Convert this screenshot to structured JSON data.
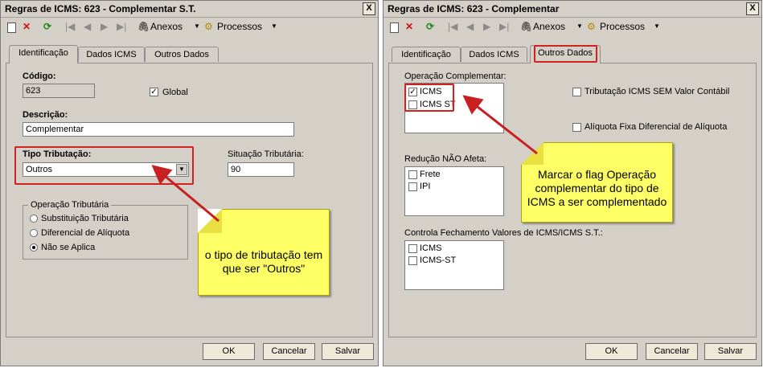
{
  "left_window": {
    "title": "Regras de ICMS: 623 - Complementar S.T.",
    "close": "X",
    "toolbar": {
      "anexos": "Anexos",
      "processos": "Processos"
    },
    "tabs": [
      "Identificação",
      "Dados ICMS",
      "Outros Dados"
    ],
    "codigo_label": "Código:",
    "codigo_value": "623",
    "global_label": "Global",
    "global_checked": "✓",
    "descricao_label": "Descrição:",
    "descricao_value": "Complementar",
    "tipo_label": "Tipo Tributação:",
    "tipo_value": "Outros",
    "situacao_label": "Situação Tributária:",
    "situacao_value": "90",
    "operacao_group": "Operação Tributária",
    "operacao_options": [
      "Substituição Tributária",
      "Diferencial de Alíquota",
      "Não se Aplica"
    ],
    "note": "o tipo de tributação tem que ser \"Outros\"",
    "buttons": {
      "ok": "OK",
      "cancel": "Cancelar",
      "save": "Salvar"
    }
  },
  "right_window": {
    "title": "Regras de ICMS: 623 - Complementar",
    "close": "X",
    "toolbar": {
      "anexos": "Anexos",
      "processos": "Processos"
    },
    "tabs": [
      "Identificação",
      "Dados ICMS",
      "Outros Dados"
    ],
    "op_complementar_label": "Operação Complementar:",
    "op_complementar_items": [
      "ICMS",
      "ICMS ST"
    ],
    "icms_checked": "✓",
    "trib_sem_valor": "Tributação ICMS SEM Valor Contábil",
    "aliquota_fixa": "Alíquota Fixa Diferencial de Alíquota",
    "reducao_label": "Redução NÃO Afeta:",
    "reducao_items": [
      "Frete",
      "IPI"
    ],
    "controla_label": "Controla Fechamento Valores de ICMS/ICMS S.T.:",
    "controla_items": [
      "ICMS",
      "ICMS-ST"
    ],
    "note": "Marcar o flag Operação complementar do tipo de ICMS a ser complementado",
    "buttons": {
      "ok": "OK",
      "cancel": "Cancelar",
      "save": "Salvar"
    }
  },
  "colors": {
    "window_bg": "#d4d0c8",
    "highlight_red": "#d32020",
    "note_yellow": "#ffff66"
  },
  "icons": [
    "new-doc-icon",
    "delete-icon",
    "refresh-icon",
    "first-icon",
    "prev-icon",
    "next-icon",
    "last-icon",
    "paperclip-icon",
    "gears-icon",
    "dropdown-arrow-icon"
  ]
}
